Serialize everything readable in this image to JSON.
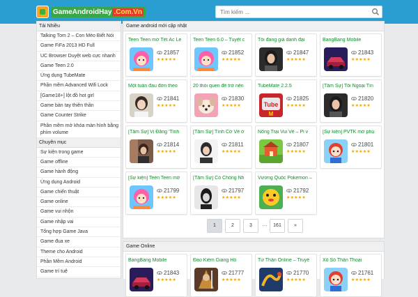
{
  "header": {
    "logo_main": "GameAndroidHay",
    "logo_accent": ".Com.Vn",
    "search_placeholder": "Tìm kiếm ..."
  },
  "sidebar": {
    "section1_title": "Tải Nhiều",
    "top_items": [
      "Talking Tom 2 – Con Mèo Biết Nói",
      "Game FiFa 2013 HD Full",
      "UC Browser Duyệt web cực nhanh",
      "Game Teen 2.0",
      "Ứng dụng TubeMate",
      "Phần mềm Advanced Wifi Lock",
      "[Game18+] lột đồ hot girl",
      "Game bàn tay thiên thần",
      "Game Counter Strike",
      "Phần mềm mở khóa màn hình bằng phím volume"
    ],
    "section2_title": "Chuyên mục",
    "categories": [
      "Sự kiện trong game",
      "Game offline",
      "Game hành động",
      "Ứng dụng Android",
      "Game chiến thuật",
      "Game online",
      "Game vui nhộn",
      "Game nhập vai",
      "Tổng hợp Game Java",
      "Game đua xe",
      "Theme cho Android",
      "Phần Mềm Android",
      "Game trí tuệ"
    ]
  },
  "new_games": {
    "title": "Game android mới cập nhật",
    "cards": [
      {
        "title": "Teen Teen mở Tết Ác Le",
        "views": "21857",
        "thumb": "pink-hair"
      },
      {
        "title": "Teen Teen 6.0 – Tuyệt c",
        "views": "21852",
        "thumb": "pink-hair"
      },
      {
        "title": "Tôi đang giả danh đại",
        "views": "21847",
        "thumb": "girl-dark"
      },
      {
        "title": "BangBang Mobile",
        "views": "21843",
        "thumb": "car"
      },
      {
        "title": "Một tuần đau đớn theo",
        "views": "21841",
        "thumb": "girl-light"
      },
      {
        "title": "20 thói quen để trở nên",
        "views": "21830",
        "thumb": "dog"
      },
      {
        "title": "TubeMate 2.2.5",
        "views": "21825",
        "thumb": "tube"
      },
      {
        "title": "[Tâm Sự] Tôi Ngoại Tìn",
        "views": "21820",
        "thumb": "girl-dark"
      },
      {
        "title": "[Tâm Sự] Vị Đắng 'Tình",
        "views": "21814",
        "thumb": "girl-room"
      },
      {
        "title": "[Tâm Sự] Tình Cờ Về ở",
        "views": "21811",
        "thumb": "girl-white"
      },
      {
        "title": "Nông Trại Vui Vẻ – Pi v",
        "views": "21807",
        "thumb": "farm"
      },
      {
        "title": "[Sự kiện] PVTK mở phụ",
        "views": "21801",
        "thumb": "chibi"
      },
      {
        "title": "[Sự kiện] Teen Teen mở",
        "views": "21799",
        "thumb": "pink-hair"
      },
      {
        "title": "[Tâm Sự] Có Chồng Nh",
        "views": "21797",
        "thumb": "girl-bw"
      },
      {
        "title": "Vương Quốc Pokemon –",
        "views": "21792",
        "thumb": "poke"
      }
    ]
  },
  "pagination": {
    "pages": [
      "1",
      "2",
      "3",
      "…",
      "161",
      "»"
    ],
    "active": "1"
  },
  "online_games": {
    "title": "Game Online",
    "cards": [
      {
        "title": "BangBang Mobile",
        "views": "21843",
        "thumb": "car"
      },
      {
        "title": "Đao Kiếm Giang Hồ",
        "views": "21777",
        "thumb": "warrior"
      },
      {
        "title": "Tứ Thần Online – Truyề",
        "views": "21770",
        "thumb": "dragon"
      },
      {
        "title": "Xổ Số Thần Thoại",
        "views": "21761",
        "thumb": "chibi"
      }
    ]
  },
  "rating": "★★★★★",
  "colors": {
    "header_bg": "#2a9ed1",
    "title_green": "#118a2c",
    "star": "#f0a202"
  }
}
